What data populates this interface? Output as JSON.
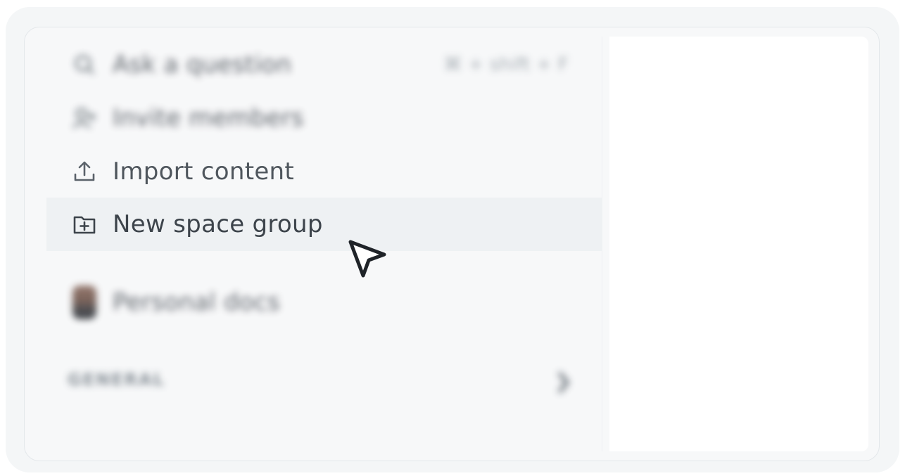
{
  "menu": {
    "ask": {
      "label": "Ask a question",
      "shortcut": "⌘ + shift + F",
      "icon": "search-icon"
    },
    "invite": {
      "label": "Invite members",
      "icon": "add-person-icon"
    },
    "import": {
      "label": "Import content",
      "icon": "upload-icon"
    },
    "new_group": {
      "label": "New space group",
      "icon": "folder-plus-icon"
    },
    "personal": {
      "label": "Personal docs",
      "icon": "avatar"
    }
  },
  "section": {
    "label": "GENERAL",
    "icon": "chevron-right-icon"
  },
  "colors": {
    "hover_bg": "#eef1f3",
    "sidebar_bg": "#f7f8f9",
    "text": "#4f565d"
  }
}
